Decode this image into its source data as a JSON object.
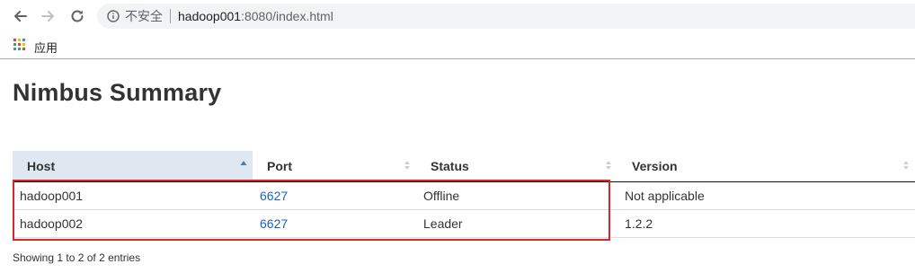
{
  "browser": {
    "security_label": "不安全",
    "url_host": "hadoop001",
    "url_rest": ":8080/index.html",
    "bookmarks": {
      "apps_label": "应用"
    },
    "icons": {
      "back": "arrow-back-icon",
      "forward": "arrow-forward-icon",
      "reload": "reload-icon",
      "info": "info-icon",
      "apps": "apps-grid-icon"
    }
  },
  "page": {
    "title": "Nimbus Summary",
    "table": {
      "columns": [
        "Host",
        "Port",
        "Status",
        "Version"
      ],
      "sorted_column": "Host",
      "sort_direction": "ascending",
      "rows": [
        {
          "host": "hadoop001",
          "port": "6627",
          "status": "Offline",
          "version": "Not applicable"
        },
        {
          "host": "hadoop002",
          "port": "6627",
          "status": "Leader",
          "version": "1.2.2"
        }
      ]
    },
    "info": "Showing 1 to 2 of 2 entries"
  },
  "colors": {
    "link": "#1a62b8",
    "sorted_header_bg": "#dfe8f1",
    "highlight_border": "#d9232d",
    "omnibox_bg": "#f1f3f4"
  }
}
